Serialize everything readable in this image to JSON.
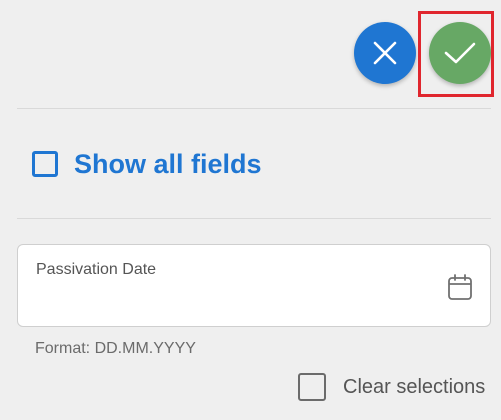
{
  "toolbar": {
    "cancel_icon": "close-icon",
    "confirm_icon": "check-icon",
    "cancel_color": "#1f76d2",
    "confirm_color": "#67a865",
    "highlight_color": "#e0262e"
  },
  "show_all_fields": {
    "label": "Show all fields",
    "checked": false,
    "color": "#1f76d2"
  },
  "passivation_date": {
    "label": "Passivation Date",
    "value": "",
    "icon": "calendar-icon",
    "hint": "Format: DD.MM.YYYY"
  },
  "clear_selections": {
    "label": "Clear selections",
    "checked": false
  }
}
